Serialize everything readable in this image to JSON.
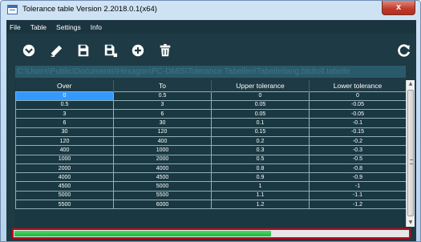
{
  "window": {
    "title": "Tolerance table  Version 2.2018.0.1(x64)",
    "close_glyph": "x"
  },
  "menu": [
    "File",
    "Table",
    "Settings",
    "Info"
  ],
  "toolbar": {
    "icons": [
      "arrow-down-circle-icon",
      "eraser-icon",
      "save-icon",
      "save-as-icon",
      "add-circle-icon",
      "delete-icon",
      "refresh-icon"
    ]
  },
  "path": "C:\\Users\\Public\\Documents\\Hexagon\\PC-DMIS\\Tolerance Tabellen\\Tabelle\\lang.bildtoll.tabelle",
  "table": {
    "columns": [
      "Over",
      "To",
      "Upper tolerance",
      "Lower tolerance"
    ],
    "rows": [
      [
        "0",
        "0.5",
        "0",
        "0"
      ],
      [
        "0.5",
        "3",
        "0.05",
        "-0.05"
      ],
      [
        "3",
        "6",
        "0.05",
        "-0.05"
      ],
      [
        "6",
        "30",
        "0.1",
        "-0.1"
      ],
      [
        "30",
        "120",
        "0.15",
        "-0.15"
      ],
      [
        "120",
        "400",
        "0.2",
        "-0.2"
      ],
      [
        "400",
        "1000",
        "0.3",
        "-0.3"
      ],
      [
        "1000",
        "2000",
        "0.5",
        "-0.5"
      ],
      [
        "2000",
        "4000",
        "0.8",
        "-0.8"
      ],
      [
        "4000",
        "4500",
        "0.9",
        "-0.9"
      ],
      [
        "4500",
        "5000",
        "1",
        "-1"
      ],
      [
        "5000",
        "5500",
        "1.1",
        "-1.1"
      ],
      [
        "5500",
        "6000",
        "1.2",
        "-1.2"
      ]
    ],
    "selected_cell": [
      0,
      0
    ]
  },
  "progress": {
    "fraction": 0.65
  },
  "colors": {
    "accent": "#3399ff",
    "progress": "#2ac84a",
    "highlight_border": "#d0021b"
  }
}
